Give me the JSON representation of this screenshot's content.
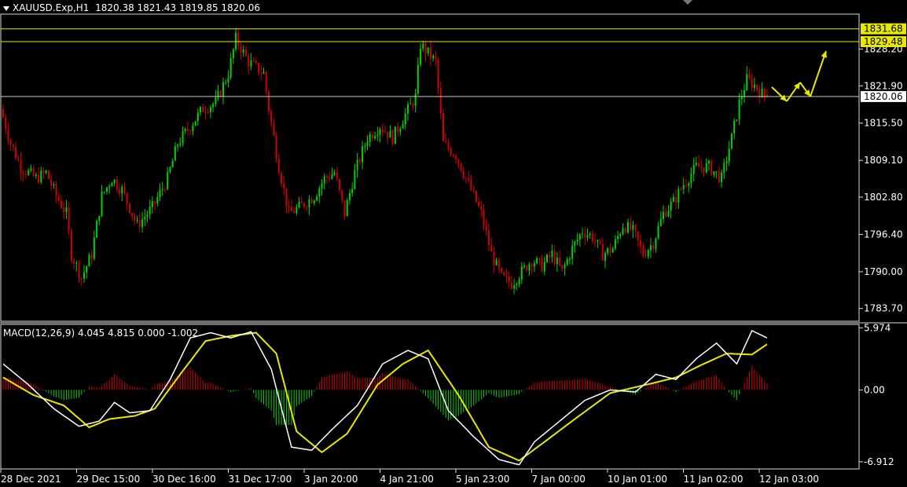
{
  "header": {
    "title": "XAUUSD.Exp,H1",
    "ohlc": "1820.38 1821.43 1819.85 1820.06",
    "indicator_label": "MACD(12,26,9) 4.045 4.815 0.000 -1.002"
  },
  "colors": {
    "background": "#000000",
    "bull": "#00d400",
    "bear": "#d10000",
    "macd_line": "#ffffff",
    "signal_line": "#e8e800",
    "level_line": "#e8e800",
    "bid_line": "#c8c8c8",
    "arrows": "#e8e800"
  },
  "price_axis": {
    "ticks": [
      "1828.20",
      "1821.90",
      "1815.50",
      "1809.10",
      "1802.80",
      "1796.40",
      "1790.00",
      "1783.70"
    ],
    "levels": [
      {
        "label": "1831.68",
        "value": 1831.68
      },
      {
        "label": "1829.48",
        "value": 1829.48
      }
    ],
    "current": {
      "label": "1820.06",
      "value": 1820.06
    }
  },
  "macd_axis": {
    "ticks": [
      "5.974",
      "0.00",
      "-6.912"
    ]
  },
  "time_axis": {
    "labels": [
      "28 Dec 2021",
      "29 Dec 15:00",
      "30 Dec 16:00",
      "31 Dec 17:00",
      "3 Jan 20:00",
      "4 Jan 21:00",
      "5 Jan 23:00",
      "7 Jan 00:00",
      "10 Jan 01:00",
      "11 Jan 02:00",
      "12 Jan 03:00"
    ]
  },
  "chart_data": [
    {
      "type": "candlestick",
      "symbol": "XAUUSD.Exp",
      "timeframe": "H1",
      "ylim": [
        1781.5,
        1834.2
      ],
      "path": [
        [
          0,
          1818
        ],
        [
          4,
          1812
        ],
        [
          8,
          1808
        ],
        [
          14,
          1806
        ],
        [
          18,
          1807
        ],
        [
          22,
          1803
        ],
        [
          26,
          1800
        ],
        [
          28,
          1793
        ],
        [
          32,
          1789
        ],
        [
          36,
          1793
        ],
        [
          40,
          1803
        ],
        [
          44,
          1806
        ],
        [
          48,
          1804
        ],
        [
          52,
          1800
        ],
        [
          54,
          1798
        ],
        [
          60,
          1801
        ],
        [
          66,
          1806
        ],
        [
          70,
          1812
        ],
        [
          75,
          1815
        ],
        [
          80,
          1818
        ],
        [
          85,
          1819
        ],
        [
          90,
          1824
        ],
        [
          93,
          1830
        ],
        [
          98,
          1826
        ],
        [
          104,
          1824
        ],
        [
          106,
          1818
        ],
        [
          110,
          1808
        ],
        [
          114,
          1800
        ],
        [
          118,
          1801
        ],
        [
          124,
          1803
        ],
        [
          128,
          1806
        ],
        [
          132,
          1807
        ],
        [
          136,
          1800
        ],
        [
          140,
          1807
        ],
        [
          145,
          1813
        ],
        [
          150,
          1815
        ],
        [
          155,
          1813
        ],
        [
          160,
          1817
        ],
        [
          164,
          1820
        ],
        [
          166,
          1829
        ],
        [
          172,
          1826
        ],
        [
          175,
          1812
        ],
        [
          180,
          1810
        ],
        [
          186,
          1804
        ],
        [
          190,
          1800
        ],
        [
          194,
          1793
        ],
        [
          198,
          1789
        ],
        [
          202,
          1788
        ],
        [
          206,
          1790
        ],
        [
          210,
          1792
        ],
        [
          214,
          1791
        ],
        [
          218,
          1793
        ],
        [
          222,
          1790
        ],
        [
          226,
          1794
        ],
        [
          230,
          1797
        ],
        [
          234,
          1796
        ],
        [
          238,
          1793
        ],
        [
          242,
          1794
        ],
        [
          246,
          1798
        ],
        [
          250,
          1797
        ],
        [
          254,
          1793
        ],
        [
          258,
          1795
        ],
        [
          262,
          1800
        ],
        [
          266,
          1802
        ],
        [
          270,
          1805
        ],
        [
          275,
          1808
        ],
        [
          280,
          1808
        ],
        [
          285,
          1806
        ],
        [
          289,
          1813
        ],
        [
          292,
          1819
        ],
        [
          295,
          1823
        ],
        [
          298,
          1822
        ],
        [
          302,
          1820
        ]
      ],
      "last_ohlc": {
        "open": 1820.38,
        "high": 1821.43,
        "low": 1819.85,
        "close": 1820.06
      },
      "forecast_arrows": 4
    },
    {
      "type": "macd",
      "params": [
        12,
        26,
        9
      ],
      "ylim": [
        -7.6,
        6.3
      ],
      "macd": [
        [
          0,
          2.5
        ],
        [
          10,
          0.5
        ],
        [
          20,
          -1.8
        ],
        [
          30,
          -3.5
        ],
        [
          38,
          -3.0
        ],
        [
          44,
          -1.2
        ],
        [
          50,
          -2.2
        ],
        [
          58,
          -2.0
        ],
        [
          66,
          1.0
        ],
        [
          74,
          5.0
        ],
        [
          82,
          5.5
        ],
        [
          90,
          5.0
        ],
        [
          98,
          5.6
        ],
        [
          106,
          2.0
        ],
        [
          114,
          -5.5
        ],
        [
          122,
          -5.8
        ],
        [
          130,
          -3.8
        ],
        [
          140,
          -1.5
        ],
        [
          150,
          2.5
        ],
        [
          160,
          3.8
        ],
        [
          168,
          3.0
        ],
        [
          176,
          -2.0
        ],
        [
          186,
          -4.5
        ],
        [
          196,
          -6.7
        ],
        [
          204,
          -7.2
        ],
        [
          210,
          -5.0
        ],
        [
          220,
          -3.0
        ],
        [
          230,
          -1.0
        ],
        [
          240,
          0.0
        ],
        [
          250,
          -0.2
        ],
        [
          258,
          1.5
        ],
        [
          266,
          1.0
        ],
        [
          274,
          3.0
        ],
        [
          282,
          4.5
        ],
        [
          290,
          2.5
        ],
        [
          296,
          5.7
        ],
        [
          302,
          5.0
        ],
        [
          306,
          4.0
        ]
      ],
      "signal": [
        [
          0,
          1.2
        ],
        [
          12,
          -0.5
        ],
        [
          24,
          -1.5
        ],
        [
          34,
          -3.6
        ],
        [
          42,
          -2.8
        ],
        [
          52,
          -2.5
        ],
        [
          60,
          -1.8
        ],
        [
          70,
          1.5
        ],
        [
          80,
          4.7
        ],
        [
          90,
          5.2
        ],
        [
          100,
          5.5
        ],
        [
          108,
          3.5
        ],
        [
          116,
          -4.0
        ],
        [
          126,
          -6.0
        ],
        [
          136,
          -4.2
        ],
        [
          148,
          0.5
        ],
        [
          158,
          2.5
        ],
        [
          168,
          3.8
        ],
        [
          180,
          -0.5
        ],
        [
          192,
          -5.5
        ],
        [
          204,
          -6.8
        ],
        [
          214,
          -5.0
        ],
        [
          226,
          -2.8
        ],
        [
          240,
          -0.3
        ],
        [
          256,
          0.6
        ],
        [
          266,
          1.2
        ],
        [
          276,
          2.4
        ],
        [
          286,
          3.5
        ],
        [
          296,
          3.4
        ],
        [
          302,
          4.4
        ],
        [
          306,
          4.815
        ]
      ]
    }
  ]
}
